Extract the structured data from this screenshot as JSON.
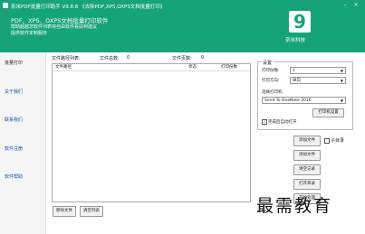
{
  "window": {
    "title": "奈米PDF批量打印助手 V9.8.8  《去除PDF,XPS,OXPS文档批量打印》",
    "minimize": "–",
    "close": "×"
  },
  "banner": {
    "line1": "PDF、XPS、OXPS文档批量打印软件",
    "line2": "帮助超越您软件列表将自由软件看好到建议",
    "line3": "提供软件定制服务",
    "logo_mark": "9",
    "logo_text": "奈米科技"
  },
  "sidebar": {
    "heading": "批量打印",
    "items": [
      {
        "label": "关于我们"
      },
      {
        "label": "联系我们"
      },
      {
        "label": "软件注册"
      },
      {
        "label": "软件帮助"
      }
    ]
  },
  "file_list": {
    "list_label": "文件路径列表:",
    "file_count_label": "文件总数:",
    "file_count": "0",
    "page_count_label": "文件页数:",
    "page_count": "0",
    "columns": [
      "文件路径",
      "状态",
      "打印份数"
    ]
  },
  "footer_buttons": {
    "remove_file": "移除文件",
    "clear_list": "清空列表"
  },
  "settings": {
    "legend": "设置",
    "copies_label": "打印份数:",
    "copies_value": "1",
    "direction_label": "打印方向:",
    "direction_value": "纵向",
    "printer_label": "选择打印机:",
    "printer_value": "Send To OneNote 2016",
    "print_settings_button": "打印机设置",
    "auto_open_label": "完成后自动打开",
    "auto_open_checked": "✓"
  },
  "actions": {
    "add_file": "添加文件",
    "add_folder": "添加文件",
    "include_subfolder": "子目录",
    "clear_record": "清空记录",
    "open_folder": "打开目录",
    "start_print": "开始处理"
  },
  "watermark": "最需教育",
  "colors": {
    "header_bg": "#16a37a",
    "sidebar_link": "#1a4f9a"
  }
}
